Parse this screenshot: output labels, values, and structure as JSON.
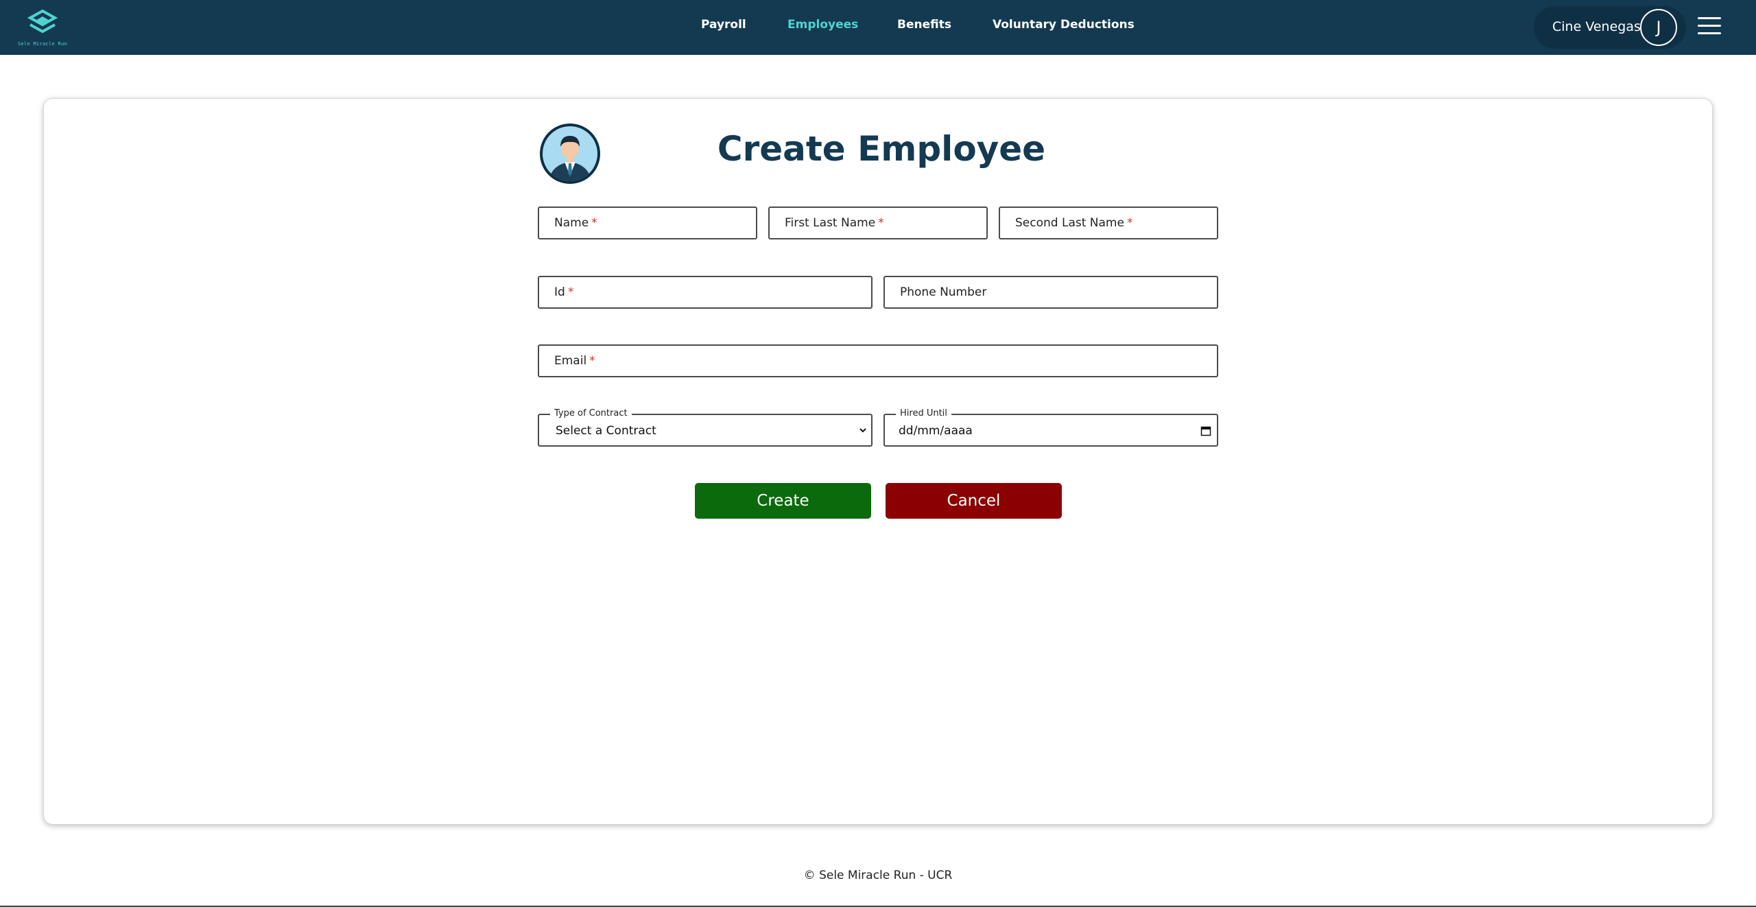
{
  "brand": {
    "name": "Sele Miracle Run",
    "accent": "#4fd3d0",
    "navbar_bg": "#143a52"
  },
  "nav": {
    "links": [
      {
        "label": "Payroll",
        "active": false
      },
      {
        "label": "Employees",
        "active": true
      },
      {
        "label": "Benefits",
        "active": false
      },
      {
        "label": "Voluntary Deductions",
        "active": false
      }
    ],
    "menu_icon": "hamburger-icon"
  },
  "user": {
    "name": "Cine Venegas",
    "initial": "J"
  },
  "form": {
    "title": "Create Employee",
    "employee_icon": "employee-avatar-icon",
    "fields": {
      "name": {
        "placeholder": "Name",
        "required_mark": "*"
      },
      "first_last_name": {
        "placeholder": "First Last Name",
        "required_mark": "*"
      },
      "second_last_name": {
        "placeholder": "Second Last Name",
        "required_mark": "*"
      },
      "id": {
        "placeholder": "Id",
        "required_mark": "*"
      },
      "phone_number": {
        "placeholder": "Phone Number"
      },
      "email": {
        "placeholder": "Email",
        "required_mark": "*"
      },
      "contract_type": {
        "label": "Type of Contract",
        "value": "Select a Contract"
      },
      "hired_until": {
        "label": "Hired Until",
        "value": "dd/mm/aaaa"
      }
    },
    "buttons": {
      "create": {
        "label": "Create",
        "color": "#0b6a0b"
      },
      "cancel": {
        "label": "Cancel",
        "color": "#8b0000"
      }
    }
  },
  "footer": {
    "text": "© Sele Miracle Run - UCR"
  }
}
